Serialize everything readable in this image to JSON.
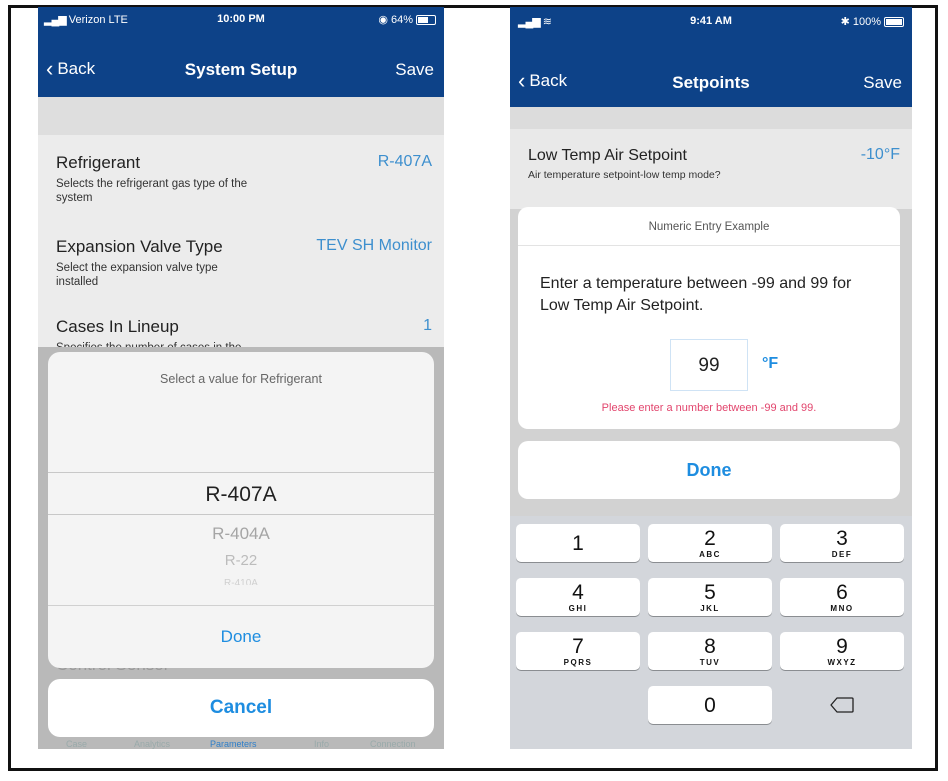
{
  "left": {
    "status": {
      "carrier": "Verizon  LTE",
      "time": "10:00 PM",
      "battery": "64%"
    },
    "nav": {
      "back": "Back",
      "title": "System Setup",
      "save": "Save"
    },
    "rows": [
      {
        "title": "Refrigerant",
        "value": "R-407A",
        "desc": "Selects the refrigerant gas type of the system"
      },
      {
        "title": "Expansion Valve Type",
        "value": "TEV SH Monitor",
        "desc": "Select the expansion valve type installed"
      },
      {
        "title": "Cases In Lineup",
        "value": "1",
        "desc": "Specifies the number of cases in the"
      }
    ],
    "picker": {
      "header": "Select a value for Refrigerant",
      "selected": "R-407A",
      "options": [
        "R-404A",
        "R-22",
        "R-410A"
      ],
      "done": "Done"
    },
    "obscured_row_title": "Control Sensor",
    "cancel": "Cancel",
    "tabs": [
      "Case",
      "Analytics",
      "Parameters",
      "Info",
      "Connection"
    ]
  },
  "right": {
    "status": {
      "time": "9:41 AM",
      "battery": "100%"
    },
    "nav": {
      "back": "Back",
      "title": "Setpoints",
      "save": "Save"
    },
    "row": {
      "title": "Low Temp Air Setpoint",
      "value": "-10°F",
      "desc": "Air temperature setpoint-low temp mode?"
    },
    "dialog": {
      "header": "Numeric Entry Example",
      "message": "Enter a temperature between -99 and 99 for Low Temp Air Setpoint.",
      "input_value": "99",
      "unit": "°F",
      "error": "Please enter a number between -99 and 99."
    },
    "done": "Done",
    "keys": [
      {
        "num": "1",
        "letters": ""
      },
      {
        "num": "2",
        "letters": "ABC"
      },
      {
        "num": "3",
        "letters": "DEF"
      },
      {
        "num": "4",
        "letters": "GHI"
      },
      {
        "num": "5",
        "letters": "JKL"
      },
      {
        "num": "6",
        "letters": "MNO"
      },
      {
        "num": "7",
        "letters": "PQRS"
      },
      {
        "num": "8",
        "letters": "TUV"
      },
      {
        "num": "9",
        "letters": "WXYZ"
      },
      {
        "num": "0",
        "letters": ""
      }
    ]
  },
  "colors": {
    "navbar": "#0d4288",
    "accent": "#1e8de0",
    "value": "#3d8fce",
    "error": "#e2456d"
  },
  "icons": [
    "signal-icon",
    "wifi-icon",
    "alarm-icon",
    "bluetooth-icon",
    "battery-icon",
    "chevron-left-icon",
    "backspace-icon"
  ]
}
